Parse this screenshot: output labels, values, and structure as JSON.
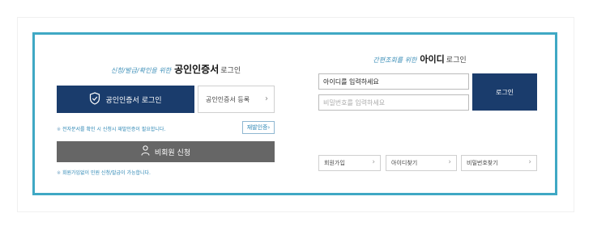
{
  "certificate_section": {
    "title_prefix": "신청/발급/확인을 위한",
    "title_main": "공인인증서",
    "title_suffix": "로그인",
    "login_button": "공인인증서 로그인",
    "register_button": "공인인증서 등록",
    "note_marker": "※",
    "note_text": "전자문서를 확인 시 신청시 재발인증이 필요합니다.",
    "guide_button": "재발인증",
    "nonmember_button": "비회원 신청",
    "member_note": "회원가입없이 민원 신청/발급이 가능합니다."
  },
  "id_section": {
    "title_prefix": "간편조회를 위한",
    "title_main": "아이디",
    "title_suffix": "로그인",
    "id_placeholder": "아이디를 입력하세요",
    "password_placeholder": "비밀번호를 입력하세요",
    "login_button": "로그인",
    "join_button": "회원가입",
    "find_id_button": "아이디찾기",
    "find_password_button": "비밀번호찾기"
  },
  "icons": {
    "shield": "shield-check-icon",
    "person": "person-icon",
    "chevron": "chevron-right-icon"
  },
  "colors": {
    "frame_border": "#3fa8c4",
    "primary_button": "#1a3c6c",
    "secondary_button": "#666666",
    "note_text": "#2b86b4"
  }
}
